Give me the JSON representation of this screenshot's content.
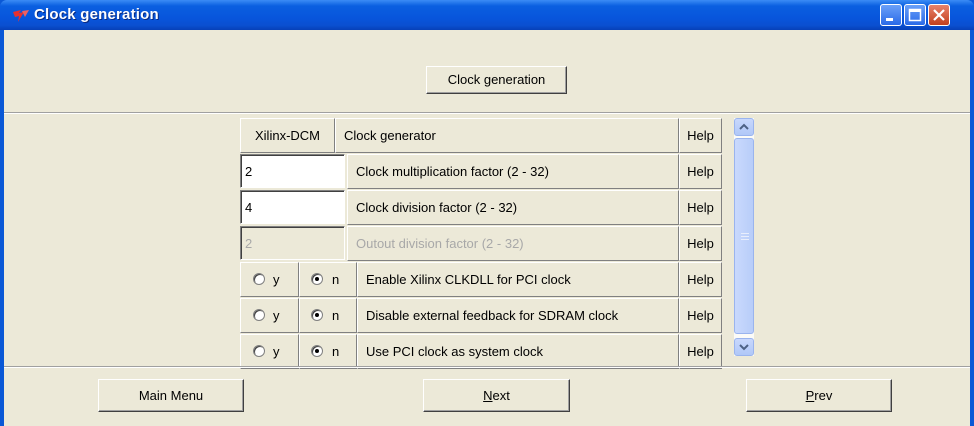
{
  "window": {
    "title": "Clock generation"
  },
  "header": {
    "button_label": "Clock generation"
  },
  "table": {
    "rows": [
      {
        "kind": "header",
        "left": "Xilinx-DCM",
        "label": "Clock generator",
        "help": "Help"
      },
      {
        "kind": "input",
        "value": "2",
        "label": "Clock multiplication factor (2 - 32)",
        "help": "Help",
        "enabled": true
      },
      {
        "kind": "input",
        "value": "4",
        "label": "Clock division factor (2 - 32)",
        "help": "Help",
        "enabled": true
      },
      {
        "kind": "input",
        "value": "2",
        "label": "Outout division factor (2 - 32)",
        "help": "Help",
        "enabled": false
      },
      {
        "kind": "radio",
        "y_label": "y",
        "n_label": "n",
        "selected": "n",
        "label": "Enable Xilinx CLKDLL for PCI clock",
        "help": "Help"
      },
      {
        "kind": "radio",
        "y_label": "y",
        "n_label": "n",
        "selected": "n",
        "label": "Disable external feedback for SDRAM clock",
        "help": "Help"
      },
      {
        "kind": "radio",
        "y_label": "y",
        "n_label": "n",
        "selected": "n",
        "label": "Use PCI clock as system clock",
        "help": "Help"
      }
    ]
  },
  "footer": {
    "main_menu": "Main Menu",
    "next_letter": "N",
    "next_rest": "ext",
    "prev_letter": "P",
    "prev_rest": "rev"
  },
  "colors": {
    "title_bar": "#0a58d6",
    "face": "#ece9d8",
    "disabled_text": "#a8a8a8"
  }
}
